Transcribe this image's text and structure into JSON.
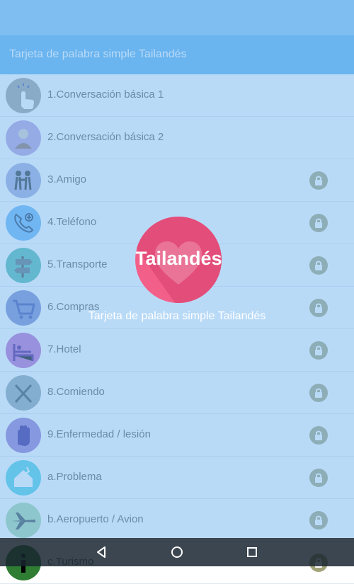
{
  "app": {
    "title": "Tarjeta de palabra simple Tailandés"
  },
  "colors": {
    "accent": "#5ab0ee",
    "status_bar": "#84c4f0",
    "splash_logo": "#f2608a",
    "overlay": "#78b9f0"
  },
  "categories": [
    {
      "label": "1.Conversación básica 1",
      "icon": "tap-hand-icon",
      "color": "#9e9e9e",
      "locked": false
    },
    {
      "label": "2.Conversación básica 2",
      "icon": "person-icon",
      "color": "#b39ddb",
      "locked": false
    },
    {
      "label": "3.Amigo",
      "icon": "friends-icon",
      "color": "#9fa8da",
      "locked": true
    },
    {
      "label": "4.Teléfono",
      "icon": "phone-icon",
      "color": "#64b5f6",
      "locked": true
    },
    {
      "label": "5.Transporte",
      "icon": "signpost-icon",
      "color": "#4db6ac",
      "locked": true
    },
    {
      "label": "6.Compras",
      "icon": "cart-icon",
      "color": "#7986cb",
      "locked": true
    },
    {
      "label": "7.Hotel",
      "icon": "bed-icon",
      "color": "#ba68c8",
      "locked": true
    },
    {
      "label": "8.Comiendo",
      "icon": "fork-knife-icon",
      "color": "#90a4ae",
      "locked": true
    },
    {
      "label": "9.Enfermedad / lesión",
      "icon": "hand-stop-icon",
      "color": "#9575cd",
      "locked": true
    },
    {
      "label": "a.Problema",
      "icon": "house-damage-icon",
      "color": "#4dd0e1",
      "locked": true
    },
    {
      "label": "b.Aeropuerto / Avion",
      "icon": "airplane-icon",
      "color": "#a5d6a7",
      "locked": true
    },
    {
      "label": "c.Turismo",
      "icon": "info-icon",
      "color": "#2e7d32",
      "locked": true
    }
  ],
  "splash": {
    "logo_text": "Tailandés",
    "caption": "Tarjeta de palabra simple Tailandés"
  },
  "navigation": {
    "back": "back-icon",
    "home": "home-icon",
    "recents": "recents-icon"
  }
}
